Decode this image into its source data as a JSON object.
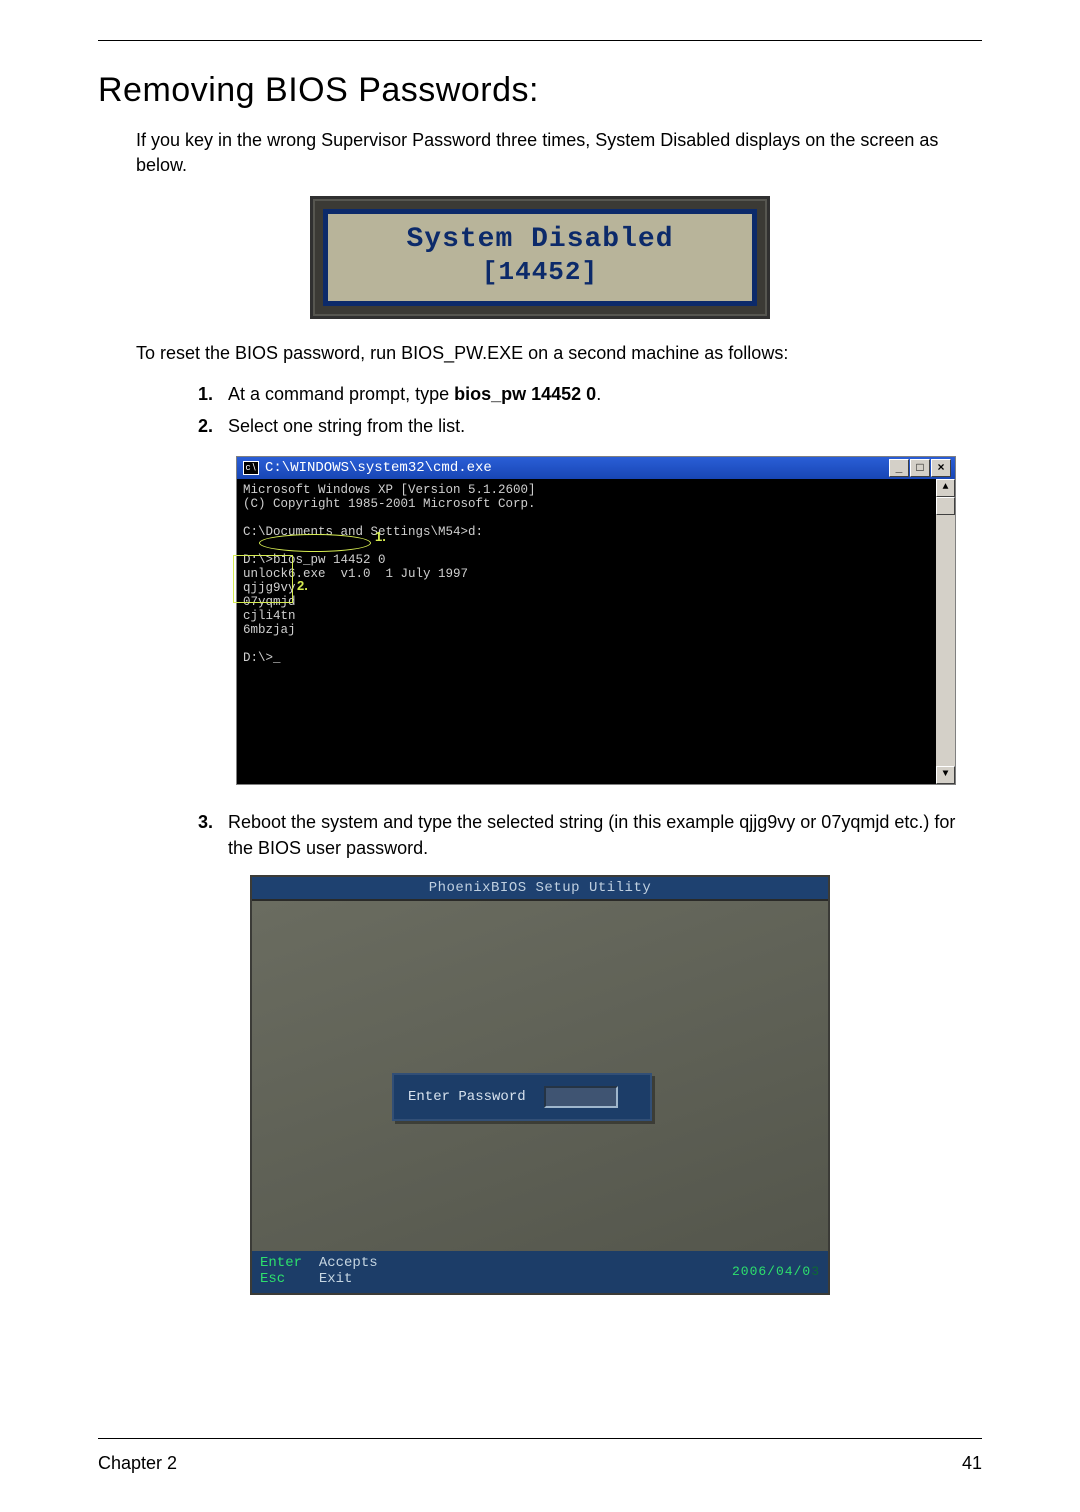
{
  "heading": "Removing BIOS Passwords:",
  "intro": "If you key in the wrong Supervisor Password three times, System Disabled displays on the screen as below.",
  "disabled_box": {
    "line1": "System Disabled",
    "line2": "[14452]"
  },
  "intro2": "To reset the BIOS password, run BIOS_PW.EXE on a second machine as follows:",
  "step1": {
    "prefix": "At a command prompt, type ",
    "bold": "bios_pw 14452 0",
    "suffix": "."
  },
  "step2": "Select one string from the list.",
  "cmd": {
    "title": "C:\\WINDOWS\\system32\\cmd.exe",
    "btn_min": "_",
    "btn_max": "□",
    "btn_close": "×",
    "scroll_up": "▲",
    "scroll_down": "▼",
    "lines": [
      "Microsoft Windows XP [Version 5.1.2600]",
      "(C) Copyright 1985-2001 Microsoft Corp.",
      "",
      "C:\\Documents and Settings\\M54>d:",
      "",
      "D:\\>bios_pw 14452 0",
      "unlock6.exe  v1.0  1 July 1997",
      "qjjg9vy",
      "07yqmjd",
      "cjli4tn",
      "6mbzjaj",
      "",
      "D:\\>_"
    ],
    "callout1": "1.",
    "callout2": "2."
  },
  "step3": "Reboot the system and type the selected string (in this example qjjg9vy or 07yqmjd etc.) for the BIOS user password.",
  "bios": {
    "title": "PhoenixBIOS Setup Utility",
    "dialog_label": "Enter Password",
    "foot_enter_key": "Enter",
    "foot_enter_act": "Accepts",
    "foot_esc_key": "Esc",
    "foot_esc_act": "Exit",
    "date_a": "2006/04/0",
    "date_b": "3"
  },
  "footer": {
    "chapter": "Chapter 2",
    "page": "41"
  }
}
